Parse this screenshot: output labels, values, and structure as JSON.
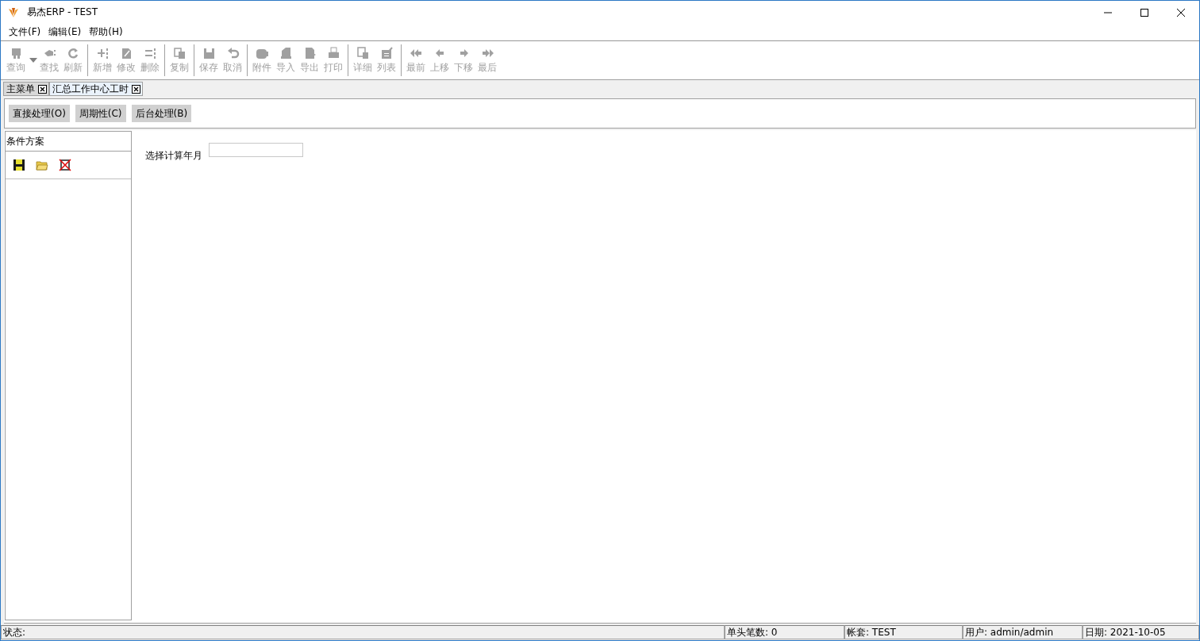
{
  "window": {
    "title": "易杰ERP - TEST"
  },
  "menu": [
    "文件(F)",
    "编辑(E)",
    "帮助(H)"
  ],
  "toolbar": [
    [
      {
        "label": "查询",
        "disabled": true,
        "dropdown": true
      },
      {
        "label": "查找",
        "disabled": true
      },
      {
        "label": "刷新",
        "disabled": true
      }
    ],
    [
      {
        "label": "新增",
        "disabled": true
      },
      {
        "label": "修改",
        "disabled": true
      },
      {
        "label": "删除",
        "disabled": true
      }
    ],
    [
      {
        "label": "复制",
        "disabled": true
      }
    ],
    [
      {
        "label": "保存",
        "disabled": true
      },
      {
        "label": "取消",
        "disabled": true
      }
    ],
    [
      {
        "label": "附件",
        "disabled": true
      },
      {
        "label": "导入",
        "disabled": true
      },
      {
        "label": "导出",
        "disabled": true
      },
      {
        "label": "打印",
        "disabled": true
      }
    ],
    [
      {
        "label": "详细",
        "disabled": true
      },
      {
        "label": "列表",
        "disabled": true
      }
    ],
    [
      {
        "label": "最前",
        "disabled": true
      },
      {
        "label": "上移",
        "disabled": true
      },
      {
        "label": "下移",
        "disabled": true
      },
      {
        "label": "最后",
        "disabled": true
      }
    ]
  ],
  "tabs": [
    {
      "label": "主菜单",
      "selected": false
    },
    {
      "label": "汇总工作中心工时",
      "selected": true
    }
  ],
  "actions": [
    "直接处理(O)",
    "周期性(C)",
    "后台处理(B)"
  ],
  "side_panel": {
    "title": "条件方案"
  },
  "form": {
    "label": "选择计算年月"
  },
  "status_bar": [
    "状态:",
    "单头笔数: 0",
    "帐套: TEST",
    "用户: admin/admin",
    "日期: 2021-10-05"
  ]
}
